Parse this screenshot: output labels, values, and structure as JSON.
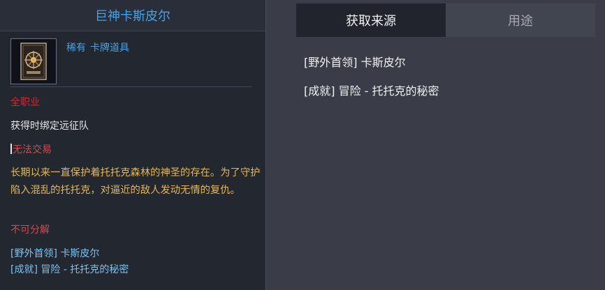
{
  "item": {
    "name": "巨神卡斯皮尔",
    "rarity": "稀有",
    "type": "卡牌道具",
    "icon": "card-icon",
    "class_requirement": "全职业",
    "binding": "获得时绑定远征队",
    "trade": "无法交易",
    "description": "长期以来一直保护着托托克森林的神圣的存在。为了守护陷入混乱的托托克，对逼近的敌人发动无情的复仇。",
    "disassemble": "不可分解",
    "sources": [
      "[野外首领] 卡斯皮尔",
      "[成就] 冒险 - 托托克的秘密"
    ]
  },
  "tabs": [
    {
      "label": "获取来源",
      "active": true
    },
    {
      "label": "用途",
      "active": false
    }
  ],
  "source_panel": {
    "items": [
      "[野外首领] 卡斯皮尔",
      "[成就] 冒险 - 托托克的秘密"
    ]
  },
  "colors": {
    "title": "#3fa4ea",
    "class_requirement": "#e0242c",
    "trade": "#d14b48",
    "description": "#e5b84c",
    "source_link": "#7dc3f0"
  }
}
